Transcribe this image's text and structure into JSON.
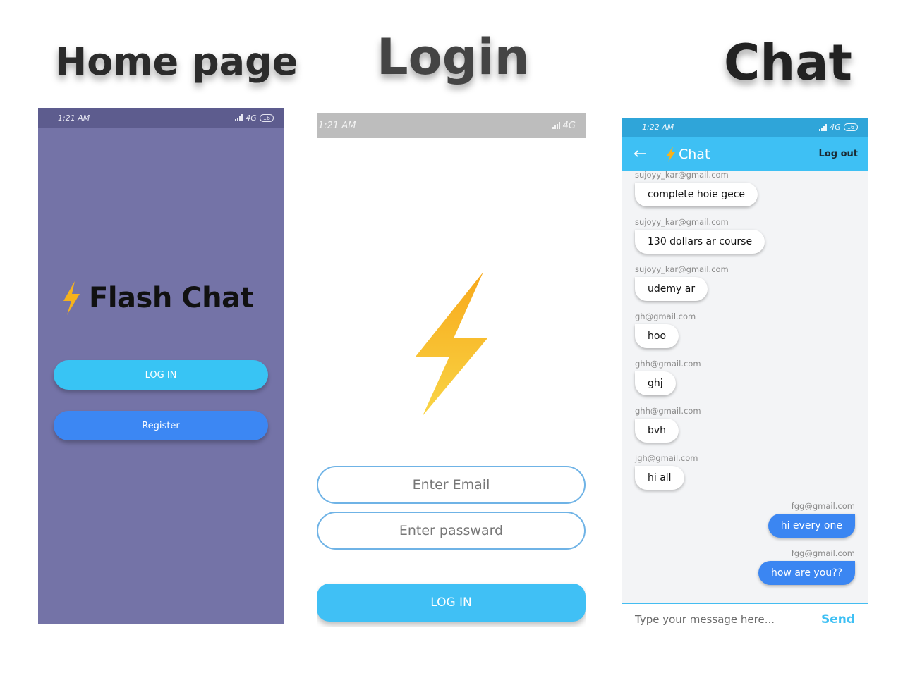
{
  "headings": {
    "home": "Home page",
    "login": "Login",
    "chat": "Chat"
  },
  "colors": {
    "home_bg": "#7473a7",
    "primary_light_blue": "#40c0f5",
    "primary_blue": "#3b86f2",
    "bolt": "#f6b21c"
  },
  "home": {
    "status_time": "1:21 AM",
    "status_network": "4G",
    "battery": "16",
    "app_title": "Flash Chat",
    "logo_icon": "lightning-bolt-icon",
    "login_label": "LOG IN",
    "register_label": "Register"
  },
  "login": {
    "status_time": "1:21 AM",
    "status_network": "4G",
    "logo_icon": "lightning-bolt-icon",
    "email_placeholder": "Enter Email",
    "password_placeholder": "Enter passward",
    "login_label": "LOG IN"
  },
  "chat": {
    "status_time": "1:22 AM",
    "status_network": "4G",
    "battery": "16",
    "appbar": {
      "title": "Chat",
      "logout_label": "Log out",
      "back_icon": "back-arrow-icon"
    },
    "messages": [
      {
        "sender": "sujoyy_kar@gmail.com",
        "text": "complete hoie gece",
        "me": false
      },
      {
        "sender": "sujoyy_kar@gmail.com",
        "text": "130 dollars ar course",
        "me": false
      },
      {
        "sender": "sujoyy_kar@gmail.com",
        "text": "udemy ar",
        "me": false
      },
      {
        "sender": "gh@gmail.com",
        "text": "hoo",
        "me": false
      },
      {
        "sender": "ghh@gmail.com",
        "text": "ghj",
        "me": false
      },
      {
        "sender": "ghh@gmail.com",
        "text": "bvh",
        "me": false
      },
      {
        "sender": "jgh@gmail.com",
        "text": "hi all",
        "me": false
      },
      {
        "sender": "fgg@gmail.com",
        "text": "hi every one",
        "me": true
      },
      {
        "sender": "fgg@gmail.com",
        "text": "how are you??",
        "me": true
      }
    ],
    "input_placeholder": "Type your message here...",
    "send_label": "Send"
  }
}
